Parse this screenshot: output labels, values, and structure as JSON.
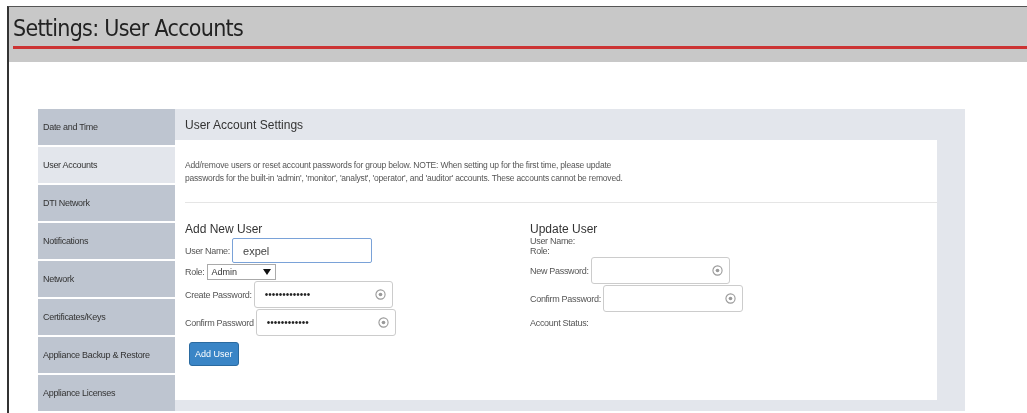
{
  "page_title": "Settings: User Accounts",
  "sidebar": {
    "items": [
      {
        "label": "Date and Time",
        "selected": false
      },
      {
        "label": "User Accounts",
        "selected": true
      },
      {
        "label": "DTI Network",
        "selected": false
      },
      {
        "label": "Notifications",
        "selected": false
      },
      {
        "label": "Network",
        "selected": false
      },
      {
        "label": "Certificates/Keys",
        "selected": false
      },
      {
        "label": "Appliance Backup & Restore",
        "selected": false
      },
      {
        "label": "Appliance Licenses",
        "selected": false
      }
    ]
  },
  "panel": {
    "title": "User Account Settings",
    "note": "Add/remove users or reset account passwords for group below. NOTE: When setting up for the first time, please update passwords for the built-in 'admin', 'monitor', 'analyst', 'operator', and 'auditor' accounts. These accounts cannot be removed.",
    "add_user": {
      "heading": "Add New User",
      "user_name_label": "User Name:",
      "user_name_value": "expel",
      "role_label": "Role:",
      "role_value": "Admin",
      "create_password_label": "Create Password:",
      "create_password_value": "•••••••••••••",
      "confirm_password_label": "Confirm Password",
      "confirm_password_value": "••••••••••••",
      "button": "Add User"
    },
    "update_user": {
      "heading": "Update User",
      "user_name_label": "User Name:",
      "role_label": "Role:",
      "new_password_label": "New Password:",
      "confirm_password_label": "Confirm Password:",
      "account_status_label": "Account Status:"
    }
  }
}
